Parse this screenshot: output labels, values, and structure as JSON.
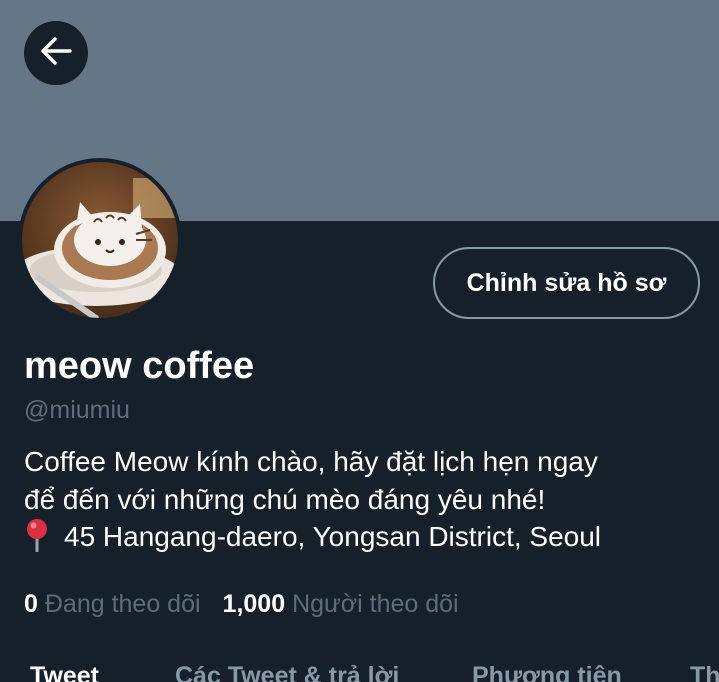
{
  "header": {
    "back_icon": "arrow-left-icon"
  },
  "profile": {
    "avatar_icon": "cat-latte-art-avatar",
    "edit_button_label": "Chỉnh sửa hồ sơ",
    "display_name": "meow coffee",
    "handle": "@miumiu",
    "bio_lines": [
      "Coffee Meow kính chào, hãy đặt lịch hẹn ngay",
      "để đến với những chú mèo đáng yêu nhé!"
    ],
    "location_icon": "round-pushpin-emoji",
    "location": "45 Hangang-daero, Yongsan District, Seoul"
  },
  "stats": {
    "following_count": "0",
    "following_label": "Đang theo dõi",
    "followers_count": "1,000",
    "followers_label": "Người theo dõi"
  },
  "tabs": [
    "Tweet",
    "Các Tweet & trả lời",
    "Phương tiện",
    "Thích"
  ],
  "colors": {
    "background": "#15202b",
    "banner": "#657786",
    "secondary_text": "#5d6d7c",
    "button_border": "#8899a6"
  }
}
